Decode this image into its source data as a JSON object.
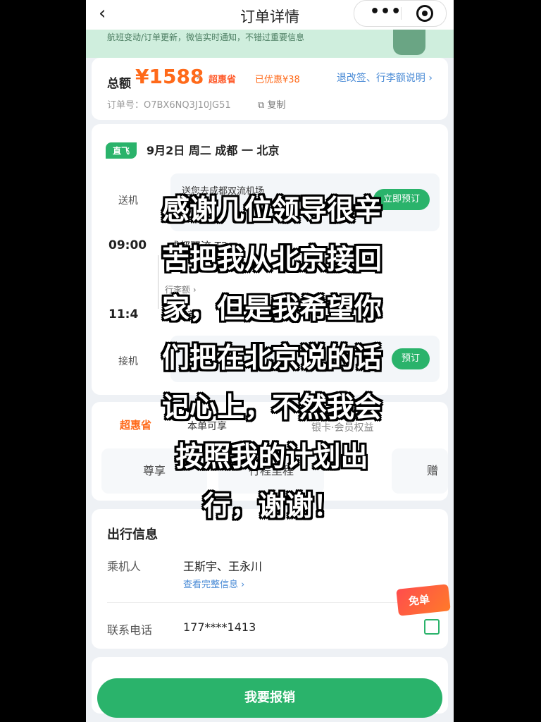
{
  "topbar": {
    "back_glyph": "‹",
    "title": "订单详情",
    "more_glyph": "•••"
  },
  "banner": {
    "text": "航班变动/订单更新，微信实时通知，不错过重要信息"
  },
  "order": {
    "total_label": "总额",
    "price": "¥1588",
    "super_label": "超惠省",
    "saved": "已优惠¥38",
    "refund_link": "退改签、行李额说明 ›",
    "order_no": "订单号：O7BX6NQ3J10JG51",
    "copy_label": "复制"
  },
  "flight": {
    "tag": "直飞",
    "route": "9月2日 周二 成都 一 北京",
    "send_label": "送机",
    "send_title": "送您去成都双流机场",
    "send_btn": "立即预订",
    "dep_time": "09:00",
    "dep_airport": "成都双流 T2",
    "luggage": "行李额 ›",
    "arr_time": "11:4",
    "arr_airport": "北京首",
    "pick_label": "接机",
    "pick_btn": "预订"
  },
  "perks": {
    "logo": "超惠省",
    "subtitle": "本单可享",
    "right": "银卡·会员权益",
    "box1": "尊享",
    "box2": "行程里程",
    "box3": "赠送"
  },
  "trip": {
    "title": "出行信息",
    "pax_label": "乘机人",
    "pax_value": "王斯宇、王永川",
    "pax_link": "查看完整信息 ›",
    "phone_label": "联系电话",
    "phone_value": "177****1413"
  },
  "free_badge": "免单",
  "cta": "我要报销",
  "overlay_lines": [
    "感谢几位领导很辛",
    "苦把我从北京接回",
    "家，但是我希望你",
    "们把在北京说的话",
    "记心上，不然我会",
    "按照我的计划出",
    "行，谢谢！"
  ],
  "colors": {
    "brand_green": "#2ab36b",
    "price_orange": "#ff6a1a",
    "link_blue": "#4a8bd6"
  }
}
